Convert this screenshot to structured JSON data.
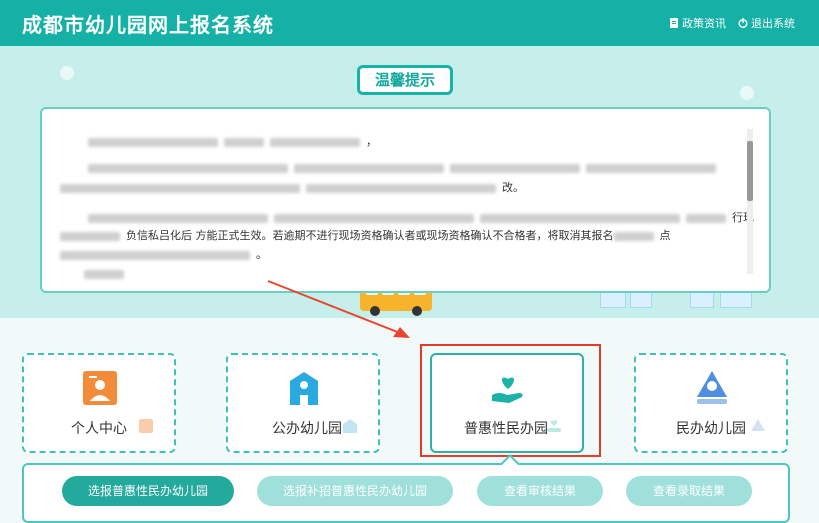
{
  "header": {
    "title": "成都市幼儿园网上报名系统",
    "policy_link": "政策资讯",
    "logout_link": "退出系统"
  },
  "notice": {
    "tag": "温馨提示",
    "line1_suffix": "，",
    "line3_suffix": "改。",
    "line4_tail": "行现",
    "line5_mid": "负信私吕化后       方能正式生效。若逾期不进行现场资格确认者或现场资格确认不合格者，将取消其报名",
    "line5_tail": "点",
    "line6_tail": "。"
  },
  "cards": [
    {
      "label": "个人中心",
      "icon": "person-card-icon"
    },
    {
      "label": "公办幼儿园",
      "icon": "public-school-icon"
    },
    {
      "label": "普惠性民办园",
      "icon": "heart-hand-icon"
    },
    {
      "label": "民办幼儿园",
      "icon": "private-school-icon"
    }
  ],
  "actions": [
    {
      "label": "选报普惠性民办幼儿园"
    },
    {
      "label": "选报补招普惠性民办幼儿园"
    },
    {
      "label": "查看审核结果"
    },
    {
      "label": "查看录取结果"
    }
  ],
  "colors": {
    "primary": "#15b1a6",
    "highlight_box": "#e43c2a",
    "arrow": "#e8452f"
  }
}
